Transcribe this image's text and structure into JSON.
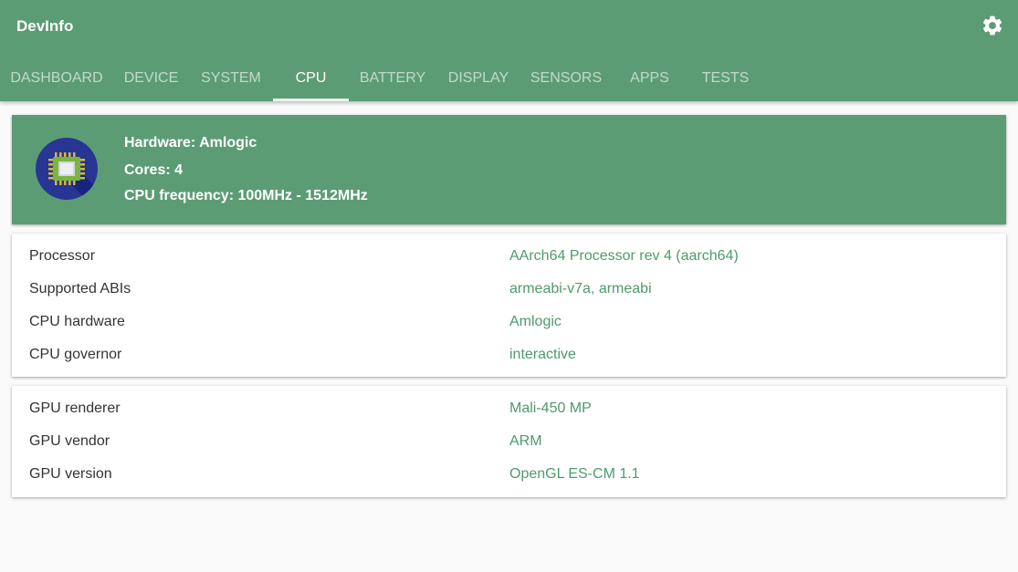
{
  "app": {
    "title": "DevInfo"
  },
  "tabs": [
    {
      "label": "DASHBOARD"
    },
    {
      "label": "DEVICE"
    },
    {
      "label": "SYSTEM"
    },
    {
      "label": "CPU"
    },
    {
      "label": "BATTERY"
    },
    {
      "label": "DISPLAY"
    },
    {
      "label": "SENSORS"
    },
    {
      "label": "APPS"
    },
    {
      "label": "TESTS"
    }
  ],
  "active_tab": "CPU",
  "summary": {
    "hardware": "Hardware: Amlogic",
    "cores": "Cores: 4",
    "frequency": "CPU frequency: 100MHz - 1512MHz",
    "icon": "cpu-chip-icon"
  },
  "cpu_info": [
    {
      "label": "Processor",
      "value": "AArch64 Processor rev 4 (aarch64)"
    },
    {
      "label": "Supported ABIs",
      "value": "armeabi-v7a, armeabi"
    },
    {
      "label": "CPU hardware",
      "value": "Amlogic"
    },
    {
      "label": "CPU governor",
      "value": "interactive"
    }
  ],
  "gpu_info": [
    {
      "label": "GPU renderer",
      "value": "Mali-450 MP"
    },
    {
      "label": "GPU vendor",
      "value": "ARM"
    },
    {
      "label": "GPU version",
      "value": "OpenGL ES-CM 1.1"
    }
  ],
  "colors": {
    "primary": "#5c9c74",
    "value_text": "#4e9a6c",
    "background": "#fafafa"
  }
}
